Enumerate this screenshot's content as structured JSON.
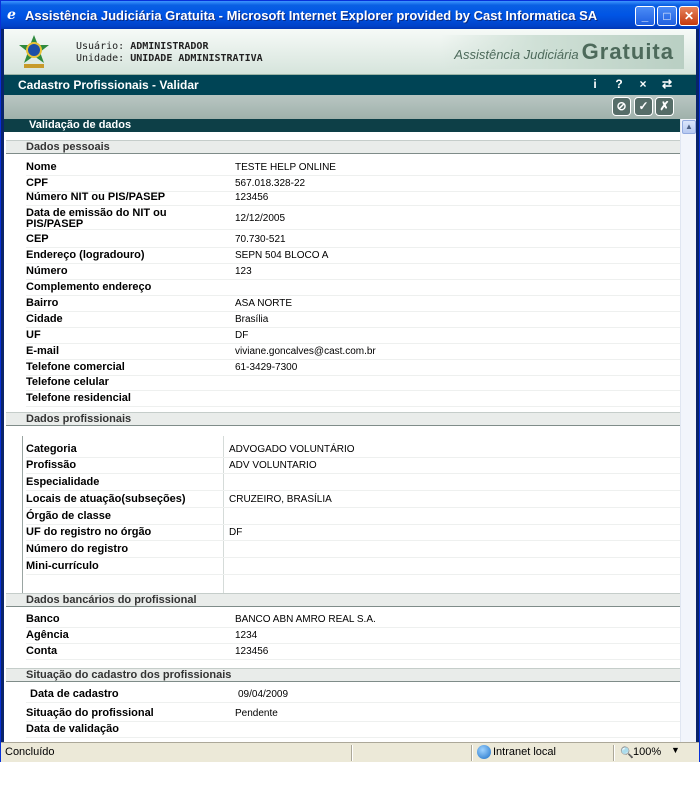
{
  "window": {
    "title": "Assistência Judiciária Gratuita - Microsoft Internet Explorer provided by Cast Informatica SA",
    "min_glyph": "_",
    "max_glyph": "□",
    "close_glyph": "✕"
  },
  "header": {
    "user_label": "Usuário:",
    "user_value": "ADMINISTRADOR",
    "unit_label": "Unidade:",
    "unit_value": "UNIDADE ADMINISTRATIVA",
    "brand_small": "Assistência Judiciária",
    "brand_big": "Gratuita"
  },
  "module": {
    "title": "Cadastro Profissionais - Validar",
    "icons": [
      "i",
      "?",
      "×",
      "⇄"
    ]
  },
  "toolbar": {
    "buttons": [
      {
        "icon": "cancel-icon",
        "glyph": "⊘"
      },
      {
        "icon": "validate-document-icon",
        "glyph": "✓"
      },
      {
        "icon": "reject-document-icon",
        "glyph": "✗"
      }
    ]
  },
  "section_title": "Validação de dados",
  "personal": {
    "title": "Dados pessoais",
    "rows": [
      {
        "label": "Nome",
        "value": "TESTE HELP ONLINE"
      },
      {
        "label": "CPF",
        "value": "567.018.328-22"
      },
      {
        "label": "Número NIT ou PIS/PASEP",
        "value": "123456"
      },
      {
        "label": "Data de emissão do NIT ou PIS/PASEP",
        "value": "12/12/2005"
      },
      {
        "label": "CEP",
        "value": "70.730-521"
      },
      {
        "label": "Endereço (logradouro)",
        "value": "SEPN 504 BLOCO A"
      },
      {
        "label": "Número",
        "value": "123"
      },
      {
        "label": "Complemento endereço",
        "value": ""
      },
      {
        "label": "Bairro",
        "value": "ASA NORTE"
      },
      {
        "label": "Cidade",
        "value": "Brasília"
      },
      {
        "label": "UF",
        "value": "DF"
      },
      {
        "label": "E-mail",
        "value": "viviane.goncalves@cast.com.br"
      },
      {
        "label": "Telefone comercial",
        "value": "61-3429-7300"
      },
      {
        "label": "Telefone celular",
        "value": ""
      },
      {
        "label": "Telefone residencial",
        "value": ""
      }
    ]
  },
  "professional": {
    "title": "Dados profissionais",
    "rows": [
      {
        "label": "Categoria",
        "value": "ADVOGADO VOLUNTÁRIO"
      },
      {
        "label": "Profissão",
        "value": "ADV VOLUNTARIO"
      },
      {
        "label": "Especialidade",
        "value": ""
      },
      {
        "label": "Locais de atuação(subseções)",
        "value": "CRUZEIRO, BRASÍLIA"
      },
      {
        "label": "Órgão de classe",
        "value": ""
      },
      {
        "label": "UF do registro no órgão",
        "value": "DF"
      },
      {
        "label": "Número do registro",
        "value": ""
      },
      {
        "label": "Mini-currículo",
        "value": ""
      }
    ]
  },
  "bank": {
    "title": "Dados bancários do profissional",
    "rows": [
      {
        "label": "Banco",
        "value": "BANCO ABN AMRO REAL S.A."
      },
      {
        "label": "Agência",
        "value": "1234"
      },
      {
        "label": "Conta",
        "value": "123456"
      }
    ]
  },
  "status": {
    "title": "Situação do cadastro dos profissionais",
    "rows": [
      {
        "label": "Data de cadastro",
        "value": "09/04/2009"
      },
      {
        "label": "Situação do profissional",
        "value": "Pendente"
      },
      {
        "label": "Data de validação",
        "value": ""
      }
    ]
  },
  "statusbar": {
    "text": "Concluído",
    "zone": "Intranet local",
    "zoom": "100%"
  }
}
